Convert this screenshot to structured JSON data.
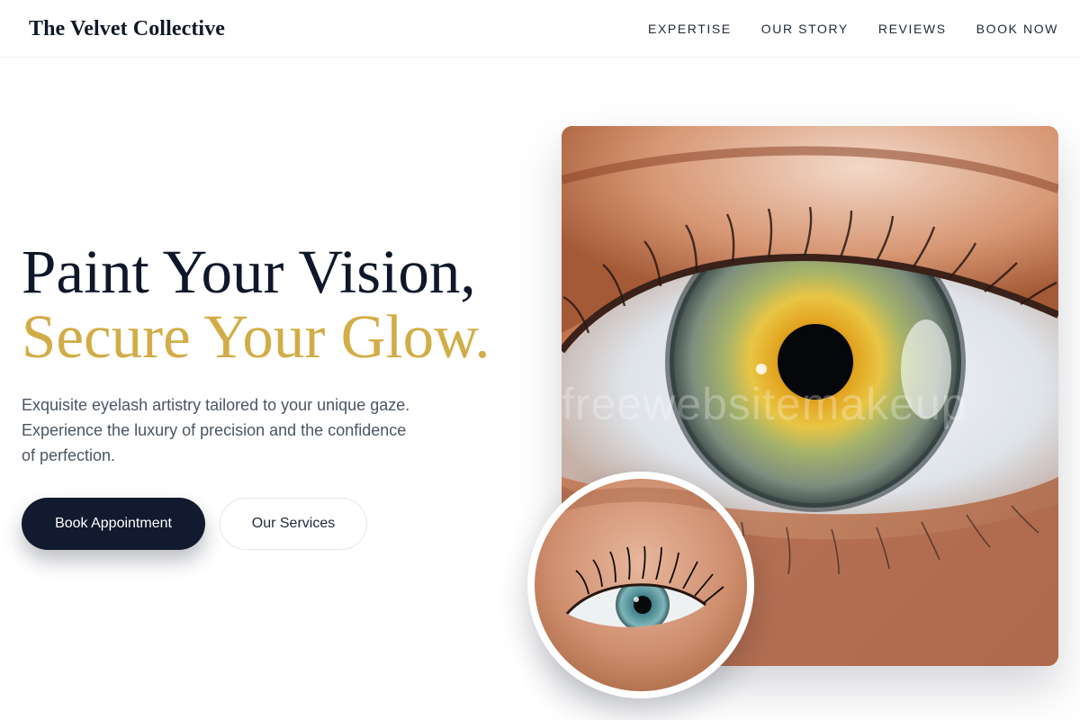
{
  "header": {
    "brand": "The Velvet Collective",
    "nav": [
      "EXPERTISE",
      "OUR STORY",
      "REVIEWS",
      "BOOK NOW"
    ]
  },
  "hero": {
    "title_line1": "Paint Your Vision,",
    "title_line2": "Secure Your Glow.",
    "subtitle": "Exquisite eyelash artistry tailored to your unique gaze. Experience the luxury of precision and the confidence of perfection.",
    "primary_button": "Book Appointment",
    "secondary_button": "Our Services"
  },
  "images": {
    "main_watermark": "freewebsitemakeup"
  },
  "colors": {
    "accent_gold": "#d2ad47",
    "navy": "#111a2e",
    "text_muted": "#4b5563"
  }
}
